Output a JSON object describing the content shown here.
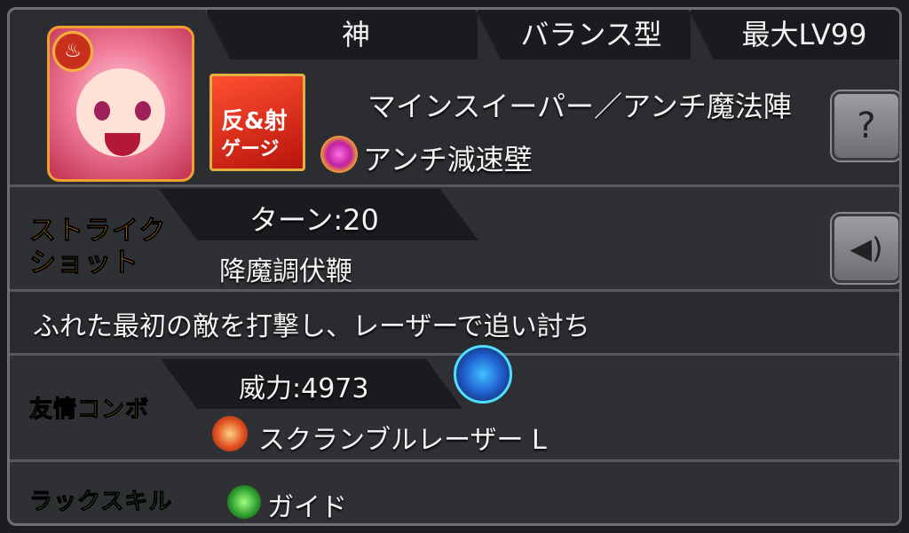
{
  "header": {
    "tab_race": "神",
    "tab_type": "バランス型",
    "tab_level": "最大LV99"
  },
  "character": {
    "badge_glyph": "♨",
    "reflect_badge_line1": "反&射",
    "reflect_badge_line2": "ゲージ",
    "abilities": "マインスイーパー／アンチ魔法陣",
    "gauge_ability": "アンチ減速壁"
  },
  "strike_shot": {
    "label_line1": "ストライク",
    "label_line2": "ショット",
    "turns": "ターン:20",
    "name": "降魔調伏鞭",
    "description": "ふれた最初の敵を打撃し、レーザーで追い討ち"
  },
  "friendship_combo": {
    "label": "友情コンボ",
    "power": "威力:4973",
    "name": "スクランブルレーザー L"
  },
  "luck_skill": {
    "label": "ラックスキル",
    "name": "ガイド"
  },
  "icons": {
    "help": "?",
    "voice": "◀)"
  },
  "colors": {
    "strike_label": "#f5a020",
    "friendship_label": "#b8f020",
    "luck_label": "#60f060"
  }
}
